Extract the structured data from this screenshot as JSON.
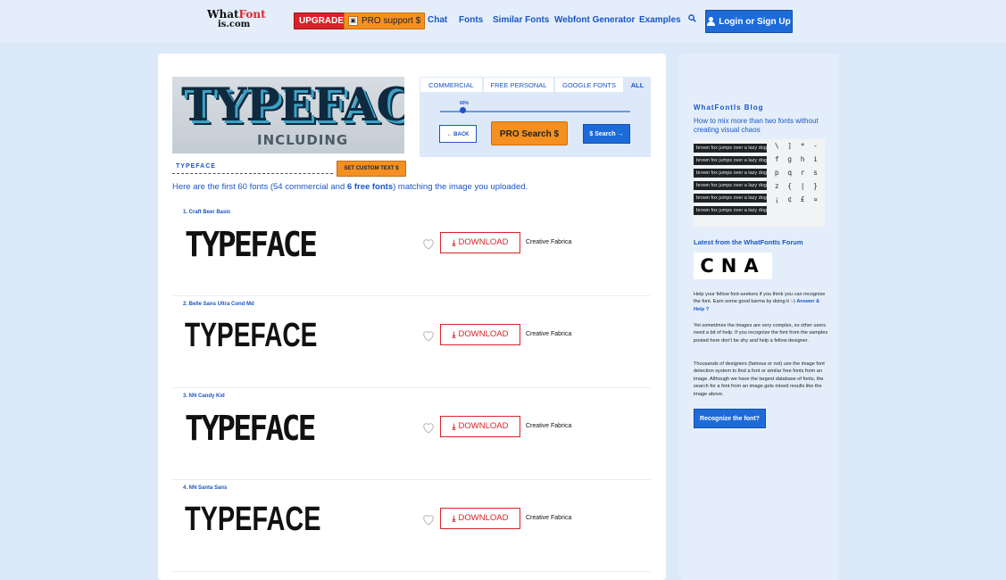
{
  "header": {
    "logo_line1": "What",
    "logo_f": "Font",
    "logo_line2": "is.com",
    "upgrade_label": "UPGRADE",
    "pro_support_label": "PRO support $",
    "nav": [
      "Chat",
      "Fonts",
      "Similar Fonts",
      "Webfont Generator",
      "Examples"
    ],
    "login_label": "Login or Sign Up"
  },
  "hero": {
    "word": "TYPEFACE",
    "sub": "INCLUDING",
    "custom_text_value": "TYPEFACE",
    "set_custom_label": "SET CUSTOM TEXT $"
  },
  "filter": {
    "tabs": [
      "COMMERCIAL",
      "FREE PERSONAL",
      "GOOGLE FONTS",
      "ALL"
    ],
    "active_tab": "ALL",
    "slider_value_label": "60%",
    "slider_value": 0.12,
    "back_label": "← BACK",
    "pro_search_label": "PRO Search $",
    "s_search_label": "$ Search →"
  },
  "results": {
    "summary_prefix": "Here are the first 60 fonts (54 commercial and ",
    "summary_bold": "6 free fonts",
    "summary_suffix": ") matching the image you uploaded.",
    "download_label": "DOWNLOAD",
    "items": [
      {
        "name": "1. Craft Beer Basic",
        "sample": "TYPEFACE",
        "foundry": "Creative Fabrica"
      },
      {
        "name": "2. Belle Sans Ultra Cond Md",
        "sample": "TYPEFACE",
        "foundry": "Creative Fabrica"
      },
      {
        "name": "3. NN Candy Kid",
        "sample": "TYPEFACE",
        "foundry": "Creative Fabrica"
      },
      {
        "name": "4. NN Santa Sans",
        "sample": "TYPEFACE",
        "foundry": "Creative Fabrica"
      }
    ]
  },
  "sidebar": {
    "blog_title": "WhatFontIs Blog",
    "blog_link": "How to mix more than two fonts without creating visual chaos",
    "blog_img_text": "brown fox jumps over a lazy dog.",
    "blog_img_glyphs": " \\  ]  *  -\n f  g  h  i\n p  q  r  s\n z  {  |  }\n ¡  ¢  £  ¤",
    "forum_title": "Latest from the WhatFontIs Forum",
    "forum_img_text": "CNA",
    "help_text": "Help your fellow font-seekers if you think you can recognize the font. Earn some good karma by doing it :-)",
    "help_link": "Answer & Help",
    "complex_text": "Yet sometimes the images are very complex, so other users need a bit of help. If you recognize the font from the samples posted here don't be shy and help a fellow designer.",
    "designers_text": "Thousands of designers (famous or not) use the image font detection system to find a font or similar free fonts from an image. Although we have the largest database of fonts, the search for a font from an image gets mixed results like the image above.",
    "recognize_label": "Recognize the font?"
  }
}
